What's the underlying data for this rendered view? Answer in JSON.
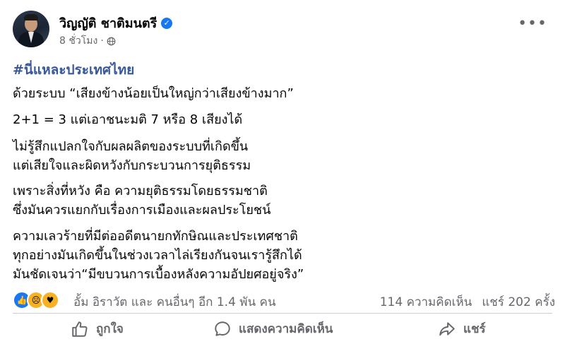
{
  "author": {
    "name": "วิญญัติ ชาติมนตรี",
    "verified": true
  },
  "meta": {
    "time": "8 ชั่วโมง",
    "separator": "·",
    "privacy_icon": "globe-icon"
  },
  "hashtag": "#นี่แหละประเทศไทย",
  "body": [
    "ด้วยระบบ “เสียงข้างน้อยเป็นใหญ่กว่าเสียงข้างมาก”",
    "2+1 = 3  แต่เอาชนะมติ 7 หรือ 8 เสียงได้",
    "ไม่รู้สึกแปลกใจกับผลผลิตของระบบที่เกิดขึ้น",
    "แต่เสียใจและผิดหวังกับกระบวนการยุติธรรม",
    "เพราะสิ่งที่หวัง คือ ความยุติธรรมโดยธรรมชาติ",
    "ซึ่งมันควรแยกกับเรื่องการเมืองและผลประโยชน์",
    "ความเลวร้ายที่มีต่ออดีตนายกทักษิณและประเทศชาติ",
    "ทุกอย่างมันเกิดขึ้นในช่วงเวลาไล่เรียงกันจนเรารู้สึกได้",
    "มันชัดเจนว่า“มีขบวนการเบื้องหลังความอัปยศอยู่จริง”"
  ],
  "reactions": {
    "icons": [
      "like-icon",
      "sad-icon",
      "care-icon"
    ],
    "text": "อั้ม อิราวัต และ คนอื่นๆ อีก 1.4 พัน คน",
    "comments": "114 ความคิดเห็น",
    "shares": "แชร์ 202 ครั้ง"
  },
  "actions": {
    "like": "ถูกใจ",
    "comment": "แสดงความคิดเห็น",
    "share": "แชร์"
  },
  "colors": {
    "accent": "#1877f2",
    "hashtag": "#385898",
    "muted": "#65676b"
  }
}
